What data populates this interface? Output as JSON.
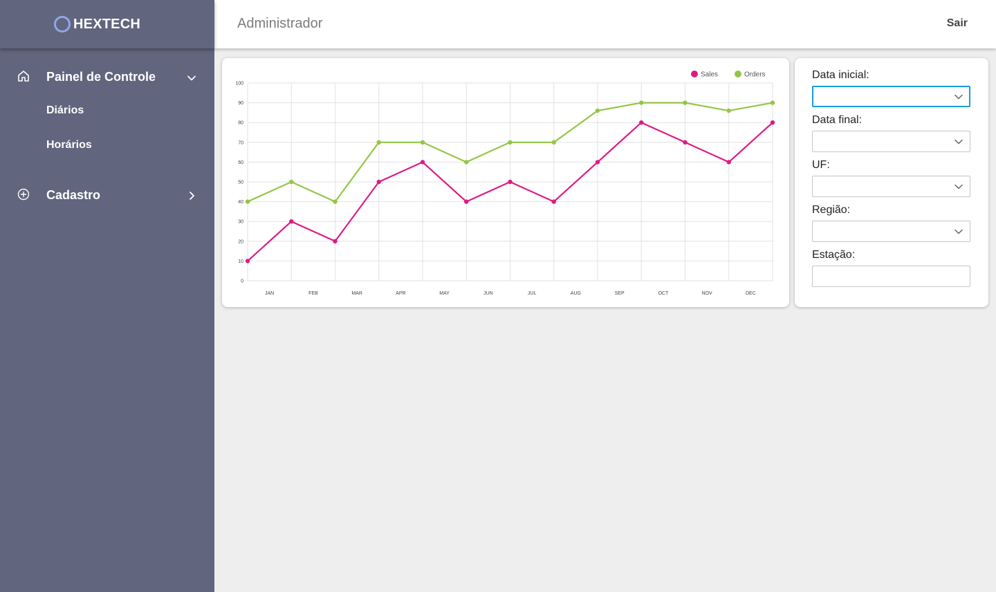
{
  "brand": {
    "name": "HEXTECH"
  },
  "header": {
    "title": "Administrador",
    "logout_label": "Sair"
  },
  "sidebar": {
    "groups": [
      {
        "label": "Painel de Controle",
        "icon": "home-icon",
        "expanded": true,
        "items": [
          {
            "label": "Diários"
          },
          {
            "label": "Horários"
          }
        ]
      },
      {
        "label": "Cadastro",
        "icon": "plus-circle-icon",
        "expanded": false,
        "items": []
      }
    ]
  },
  "filters": {
    "start_date": {
      "label": "Data inicial:",
      "value": ""
    },
    "end_date": {
      "label": "Data final:",
      "value": ""
    },
    "uf": {
      "label": "UF:",
      "value": ""
    },
    "region": {
      "label": "Região:",
      "value": ""
    },
    "station": {
      "label": "Estação:",
      "value": ""
    }
  },
  "colors": {
    "sidebar": "#61657e",
    "sales": "#de1a85",
    "orders": "#94c646",
    "focus": "#1a9ad6"
  },
  "chart_data": {
    "type": "line",
    "categories": [
      "JAN",
      "FEB",
      "MAR",
      "APR",
      "MAY",
      "JUN",
      "JUL",
      "AUG",
      "SEP",
      "OCT",
      "NOV",
      "DEC"
    ],
    "ylim": [
      0,
      100
    ],
    "yticks": [
      0,
      10,
      20,
      30,
      40,
      50,
      60,
      70,
      80,
      90,
      100
    ],
    "grid": true,
    "legend_position": "top-right",
    "series": [
      {
        "name": "Sales",
        "color": "#de1a85",
        "x": [
          0,
          1,
          2,
          3,
          4,
          5,
          6,
          7,
          8,
          9,
          10,
          11,
          12
        ],
        "values": [
          10,
          30,
          20,
          50,
          60,
          40,
          50,
          40,
          60,
          80,
          70,
          60,
          80
        ]
      },
      {
        "name": "Orders",
        "color": "#94c646",
        "x": [
          0,
          1,
          2,
          3,
          4,
          5,
          6,
          7,
          8,
          9,
          10,
          11,
          12
        ],
        "values": [
          40,
          50,
          40,
          70,
          70,
          60,
          70,
          70,
          86,
          90,
          90,
          86,
          90
        ]
      }
    ]
  }
}
